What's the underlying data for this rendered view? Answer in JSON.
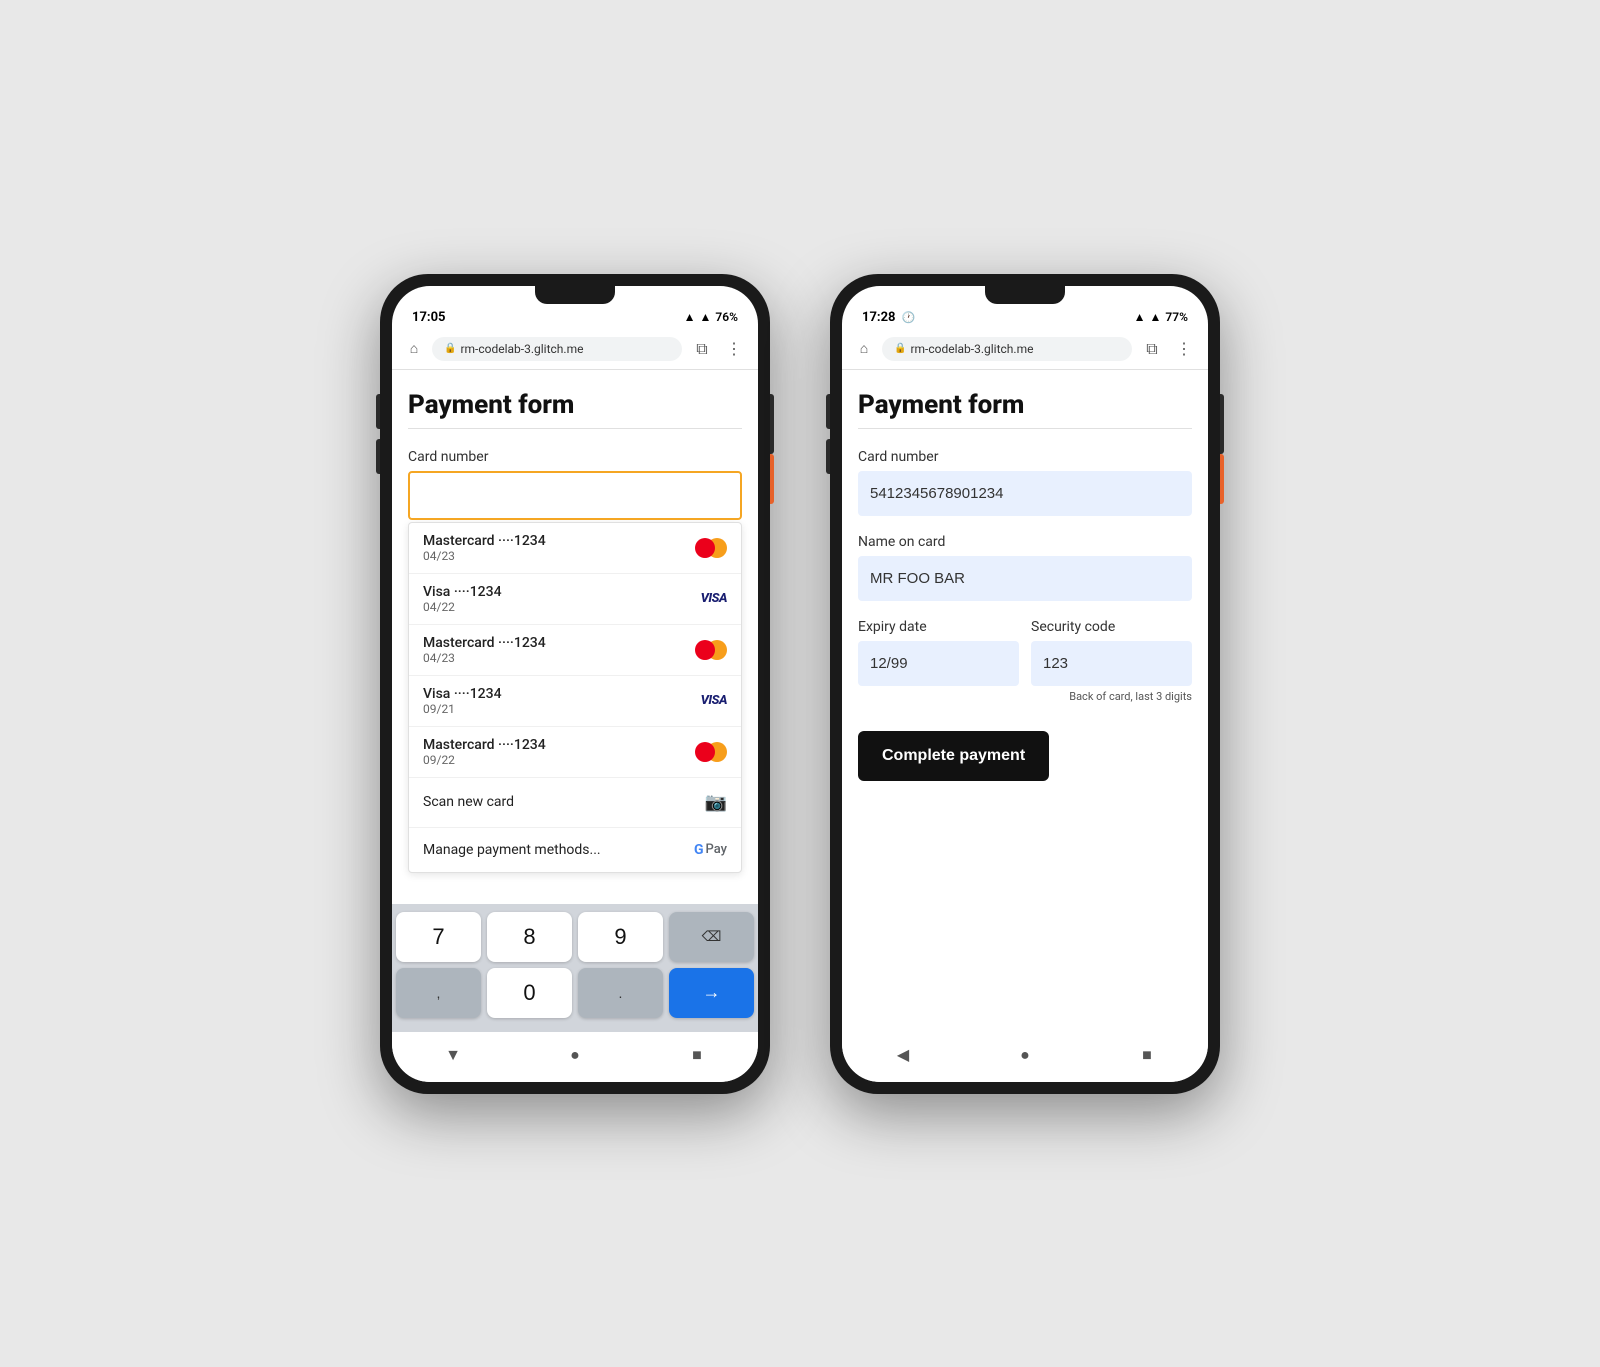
{
  "phone_left": {
    "status": {
      "time": "17:05",
      "battery": "76%"
    },
    "browser": {
      "url": "rm-codelab-3.glitch.me"
    },
    "page": {
      "title": "Payment form",
      "card_number_label": "Card number",
      "card_input_placeholder": ""
    },
    "autocomplete": {
      "items": [
        {
          "brand": "Mastercard",
          "dots": "····1234",
          "expiry": "04/23",
          "type": "mastercard"
        },
        {
          "brand": "Visa",
          "dots": "····1234",
          "expiry": "04/22",
          "type": "visa"
        },
        {
          "brand": "Mastercard",
          "dots": "····1234",
          "expiry": "04/23",
          "type": "mastercard"
        },
        {
          "brand": "Visa",
          "dots": "····1234",
          "expiry": "09/21",
          "type": "visa"
        },
        {
          "brand": "Mastercard",
          "dots": "····1234",
          "expiry": "09/22",
          "type": "mastercard"
        }
      ],
      "scan_label": "Scan new card",
      "manage_label": "Manage payment methods..."
    },
    "keyboard": {
      "rows": [
        [
          "7",
          "8",
          "9",
          "⌫"
        ],
        [
          ",",
          "0",
          ".",
          "→"
        ]
      ]
    }
  },
  "phone_right": {
    "status": {
      "time": "17:28",
      "battery": "77%"
    },
    "browser": {
      "url": "rm-codelab-3.glitch.me"
    },
    "page": {
      "title": "Payment form",
      "card_number_label": "Card number",
      "card_number_value": "5412345678901234",
      "name_label": "Name on card",
      "name_value": "MR FOO BAR",
      "expiry_label": "Expiry date",
      "expiry_value": "12/99",
      "security_label": "Security code",
      "security_value": "123",
      "security_hint": "Back of card, last 3 digits",
      "submit_label": "Complete payment"
    }
  },
  "colors": {
    "input_focused_border": "#f5a623",
    "input_filled_bg": "#e8f0fe",
    "submit_btn_bg": "#111111",
    "submit_btn_text": "#ffffff",
    "keyboard_blue": "#1a73e8"
  },
  "icons": {
    "home": "⌂",
    "lock": "🔒",
    "menu_dots": "⋮",
    "tab_icon": "⧉",
    "camera": "📷",
    "back_arrow": "◀",
    "circle": "●",
    "square": "■",
    "triangle": "▼"
  }
}
